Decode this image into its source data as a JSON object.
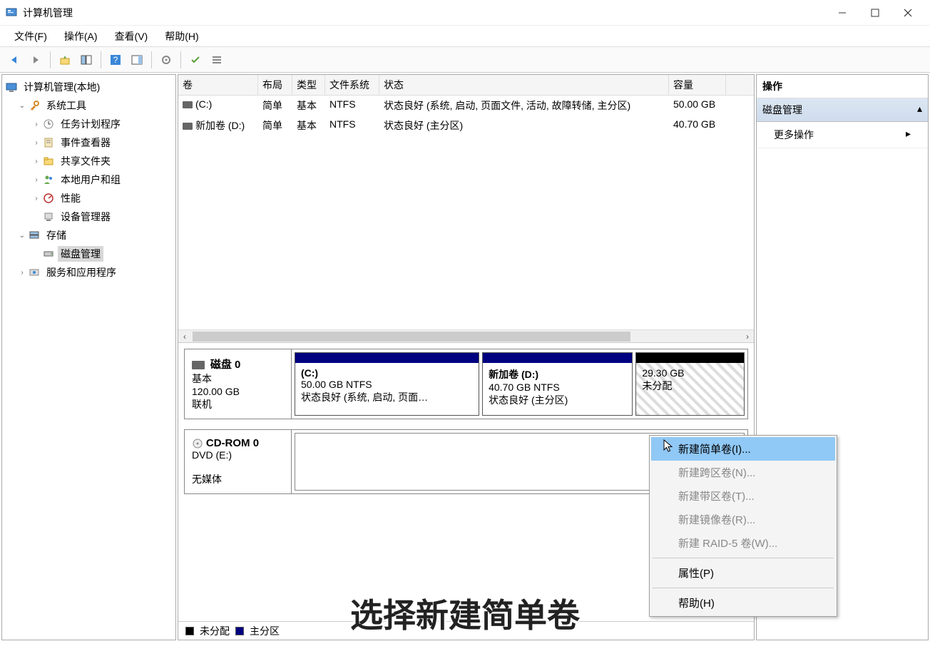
{
  "window": {
    "title": "计算机管理"
  },
  "menu": {
    "file": "文件(F)",
    "action": "操作(A)",
    "view": "查看(V)",
    "help": "帮助(H)"
  },
  "tree": {
    "root": "计算机管理(本地)",
    "sys_tools": "系统工具",
    "task_scheduler": "任务计划程序",
    "event_viewer": "事件查看器",
    "shared_folders": "共享文件夹",
    "local_users": "本地用户和组",
    "performance": "性能",
    "device_mgr": "设备管理器",
    "storage": "存储",
    "disk_mgmt": "磁盘管理",
    "services": "服务和应用程序"
  },
  "columns": {
    "volume": "卷",
    "layout": "布局",
    "type": "类型",
    "fs": "文件系统",
    "status": "状态",
    "capacity": "容量"
  },
  "volumes": [
    {
      "name": "(C:)",
      "layout": "简单",
      "type": "基本",
      "fs": "NTFS",
      "status": "状态良好 (系统, 启动, 页面文件, 活动, 故障转储, 主分区)",
      "capacity": "50.00 GB"
    },
    {
      "name": "新加卷 (D:)",
      "layout": "简单",
      "type": "基本",
      "fs": "NTFS",
      "status": "状态良好 (主分区)",
      "capacity": "40.70 GB"
    }
  ],
  "disk0": {
    "title": "磁盘 0",
    "type": "基本",
    "size": "120.00 GB",
    "state": "联机",
    "parts": [
      {
        "title": "(C:)",
        "line2": "50.00 GB NTFS",
        "line3": "状态良好 (系统, 启动, 页面…"
      },
      {
        "title": "新加卷   (D:)",
        "line2": "40.70 GB NTFS",
        "line3": "状态良好 (主分区)"
      },
      {
        "title": "",
        "line2": "29.30 GB",
        "line3": "未分配"
      }
    ]
  },
  "cdrom": {
    "title": "CD-ROM 0",
    "line2": "DVD (E:)",
    "line3": "无媒体"
  },
  "legend": {
    "unalloc": "未分配",
    "primary": "主分区"
  },
  "right": {
    "header": "操作",
    "section": "磁盘管理",
    "more": "更多操作"
  },
  "ctx": {
    "simple": "新建简单卷(I)...",
    "span": "新建跨区卷(N)...",
    "stripe": "新建带区卷(T)...",
    "mirror": "新建镜像卷(R)...",
    "raid5": "新建 RAID-5 卷(W)...",
    "props": "属性(P)",
    "help": "帮助(H)"
  },
  "subtitle": "选择新建简单卷"
}
